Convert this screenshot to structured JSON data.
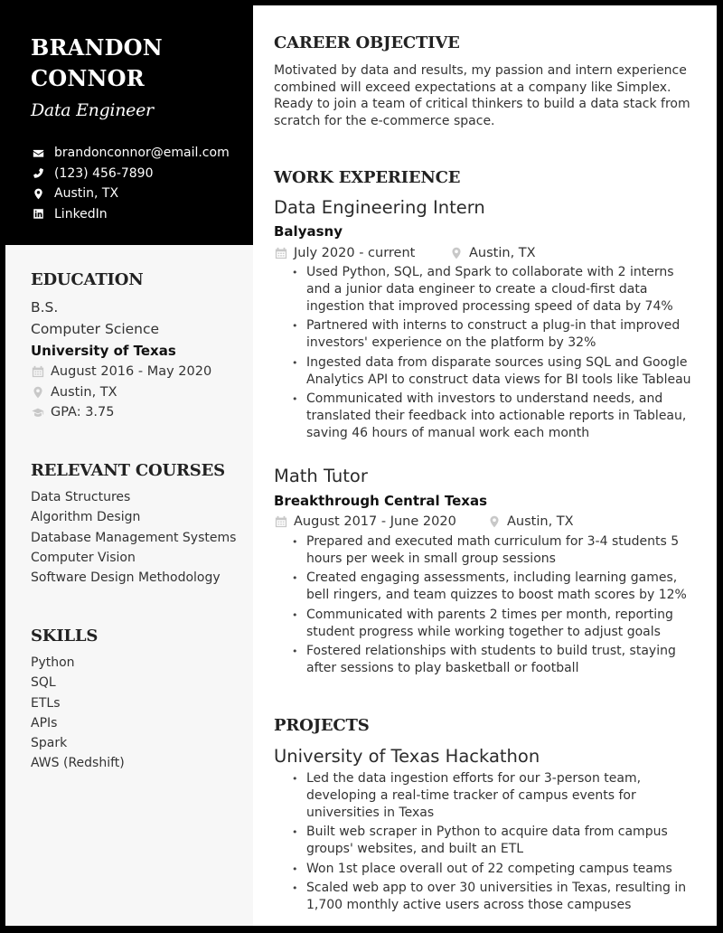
{
  "header": {
    "first_name": "BRANDON",
    "last_name": "CONNOR",
    "job_title": "Data Engineer",
    "contacts": [
      {
        "icon": "envelope-icon",
        "text": "brandonconnor@email.com"
      },
      {
        "icon": "phone-icon",
        "text": "(123) 456-7890"
      },
      {
        "icon": "map-pin-icon",
        "text": "Austin, TX"
      },
      {
        "icon": "linkedin-icon",
        "text": "LinkedIn"
      }
    ]
  },
  "education": {
    "heading": "EDUCATION",
    "degree": "B.S.",
    "major": "Computer Science",
    "school": "University of Texas",
    "dates": "August 2016 - May 2020",
    "location": "Austin, TX",
    "gpa": "GPA: 3.75"
  },
  "courses": {
    "heading": "RELEVANT COURSES",
    "items": [
      "Data Structures",
      "Algorithm Design",
      "Database Management Systems",
      "Computer Vision",
      "Software Design Methodology"
    ]
  },
  "skills": {
    "heading": "SKILLS",
    "items": [
      "Python",
      "SQL",
      "ETLs",
      "APIs",
      "Spark",
      "AWS (Redshift)"
    ]
  },
  "objective": {
    "heading": "CAREER OBJECTIVE",
    "text": "Motivated by data and results, my passion and intern experience combined will exceed expectations at a company like Simplex. Ready to join a team of critical thinkers to build a data stack from scratch for the e-commerce space."
  },
  "experience": {
    "heading": "WORK EXPERIENCE",
    "jobs": [
      {
        "title": "Data Engineering Intern",
        "company": "Balyasny",
        "dates": "July 2020 - current",
        "location": "Austin, TX",
        "bullets": [
          "Used Python, SQL, and Spark to collaborate with 2 interns and a junior data engineer to create a cloud-first data ingestion that improved processing speed of data by 74%",
          "Partnered with interns to construct a plug-in that improved investors' experience on the platform by 32%",
          "Ingested data from disparate sources using SQL and Google Analytics API to construct data views for BI tools like Tableau",
          "Communicated with investors to understand needs, and translated their feedback into actionable reports in Tableau, saving 46 hours of manual work each month"
        ]
      },
      {
        "title": "Math Tutor",
        "company": "Breakthrough Central Texas",
        "dates": "August 2017 - June 2020",
        "location": "Austin, TX",
        "bullets": [
          "Prepared and executed math curriculum for 3-4 students 5 hours per week in small group sessions",
          "Created engaging assessments, including learning games, bell ringers, and team quizzes to boost math scores by 12%",
          "Communicated with parents 2 times per month, reporting student progress while working together to adjust goals",
          "Fostered relationships with students to build trust, staying after sessions to play basketball or football"
        ]
      }
    ]
  },
  "projects": {
    "heading": "PROJECTS",
    "items": [
      {
        "title": "University of Texas Hackathon",
        "bullets": [
          "Led the data ingestion efforts for our 3-person team, developing a real-time tracker of campus events for universities in Texas",
          "Built web scraper in Python to acquire data from campus groups' websites, and built an ETL",
          "Won 1st place overall out of 22 competing campus teams",
          "Scaled web app to over 30 universities in Texas, resulting in 1,700 monthly active users across those campuses"
        ]
      }
    ]
  }
}
